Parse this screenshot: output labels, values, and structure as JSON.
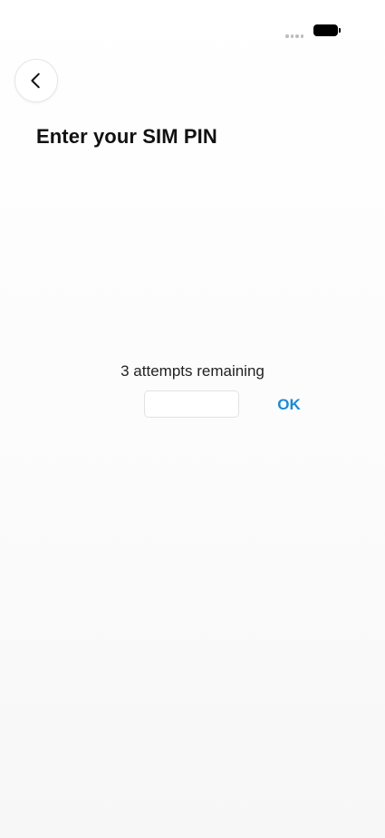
{
  "status_bar": {
    "signal_icon": "signal-dots-icon",
    "battery_icon": "battery-icon"
  },
  "header": {
    "back_icon": "chevron-left-icon",
    "title": "Enter your SIM PIN"
  },
  "pin_entry": {
    "attempts_text": "3 attempts remaining",
    "input_value": "",
    "input_placeholder": "",
    "ok_label": "OK"
  },
  "colors": {
    "accent": "#1a8ad4",
    "title": "#111111",
    "background": "#ffffff"
  }
}
